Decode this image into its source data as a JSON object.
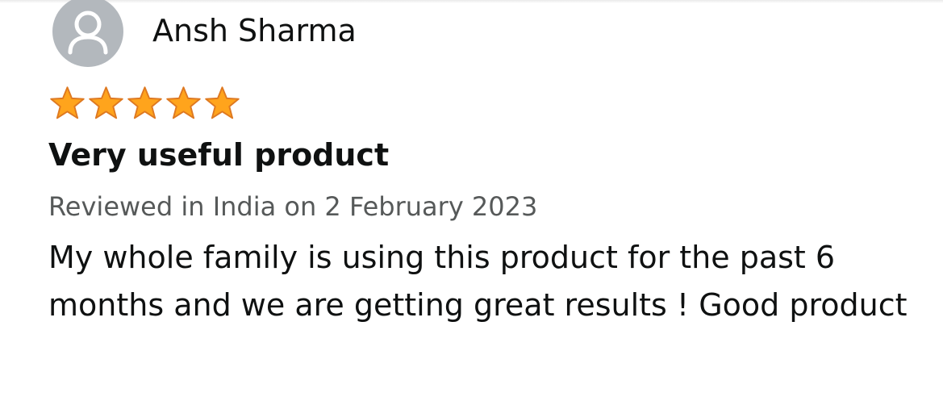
{
  "review": {
    "reviewer_name": "Ansh Sharma",
    "avatar_icon": "user-silhouette-icon",
    "rating": 5,
    "rating_max": 5,
    "star_icon": "star-icon",
    "title": "Very useful product",
    "meta": "Reviewed in India on 2 February 2023",
    "body": "My whole family is using this product for the past 6 months and we are getting great results ! Good product"
  },
  "colors": {
    "star_fill": "#ffa41c",
    "star_stroke": "#de7921",
    "avatar_bg": "#b3b8bd",
    "avatar_fg": "#ffffff",
    "meta_text": "#565959",
    "text": "#0f1111"
  }
}
